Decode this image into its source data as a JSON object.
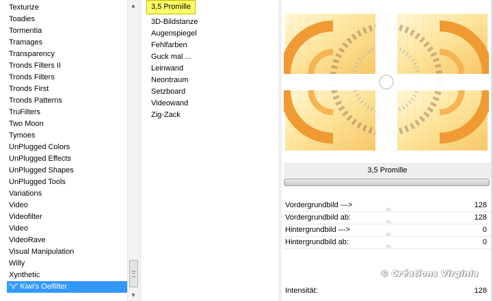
{
  "categories": {
    "items": [
      "Texturize",
      "Toadies",
      "Tormentia",
      "Tramages",
      "Transparency",
      "Tronds Filters II",
      "Tronds Filters",
      "Tronds First",
      "Tronds Patterns",
      "TruFilters",
      "Two Moon",
      "Tymoes",
      "UnPlugged Colors",
      "UnPlugged Effects",
      "UnPlugged Shapes",
      "UnPlugged Tools",
      "Variations",
      "Video",
      "Videofilter",
      "Video",
      "VideoRave",
      "Visual Manipulation",
      "Willy",
      "Xynthetic",
      "\"v\" Kiwi's Oelfilter"
    ],
    "selected_index": 24
  },
  "filters": {
    "items": [
      "3,5 Promille",
      "3D-Bildstanze",
      "Augenspiegel",
      "Fehlfarben",
      "Guck mal ...",
      "Leinwand",
      "Neontraum",
      "Setzboard",
      "Videowand",
      "Zig-Zack"
    ],
    "selected_index": 0
  },
  "preview": {
    "filter_title": "3,5 Promille",
    "params": [
      {
        "label": "Vordergrundbild --->",
        "value": "128"
      },
      {
        "label": "Vordergrundbild ab:",
        "value": "128"
      },
      {
        "label": "Hintergrundbild --->",
        "value": "0"
      },
      {
        "label": "Hintergrundbild ab:",
        "value": "0"
      },
      {
        "label": "Intensität:",
        "value": "128"
      }
    ],
    "watermark": "© Créations Virginia",
    "colors": {
      "orange": "#f0a23c",
      "light": "#fde79c",
      "pale": "#fff6d2"
    }
  },
  "icons": {
    "scroll_up": "arrow-up-icon",
    "scroll_down": "arrow-down-icon",
    "thumb_grip": "grip-icon"
  }
}
